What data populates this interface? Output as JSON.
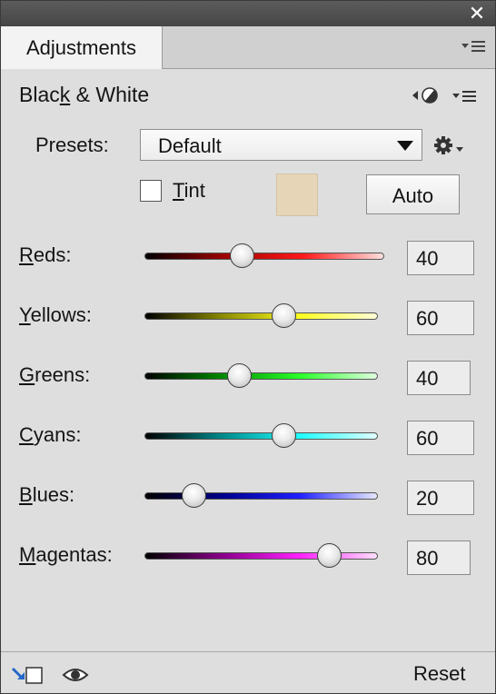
{
  "titlebar": {
    "close_icon": "close-icon"
  },
  "tabs": [
    {
      "label": "Adjustments"
    }
  ],
  "tab_menu_icon": "panel-menu-icon",
  "panel": {
    "title_prefix": "Blac",
    "title_ul": "k",
    "title_suffix": " & White",
    "mask_icon": "half-circle-mask-icon",
    "menu_icon": "panel-options-menu-icon"
  },
  "presets": {
    "label": "Presets:",
    "selected": "Default",
    "gear_icon": "gear-icon"
  },
  "tint": {
    "checked": false,
    "label_ul": "T",
    "label_rest": "int",
    "color": "#e6d6b7"
  },
  "auto_button": {
    "label": "Auto"
  },
  "channels": [
    {
      "ul": "R",
      "rest": "eds:",
      "value": "40",
      "fraction": 0.4,
      "gradient": [
        "#000000",
        "#9e0000",
        "#ff1a1a",
        "#ffe0e0"
      ]
    },
    {
      "ul": "Y",
      "rest": "ellows:",
      "value": "60",
      "fraction": 0.6,
      "gradient": [
        "#000000",
        "#8a8a00",
        "#ffff20",
        "#ffffd8"
      ]
    },
    {
      "ul": "G",
      "rest": "reens:",
      "value": "40",
      "fraction": 0.4,
      "gradient": [
        "#000000",
        "#008a00",
        "#2aff2a",
        "#e0ffe0"
      ]
    },
    {
      "ul": "C",
      "rest": "yans:",
      "value": "60",
      "fraction": 0.6,
      "gradient": [
        "#000000",
        "#008a8a",
        "#20ffff",
        "#e0ffff"
      ]
    },
    {
      "ul": "B",
      "rest": "lues:",
      "value": "20",
      "fraction": 0.2,
      "gradient": [
        "#000000",
        "#00008a",
        "#2020ff",
        "#e8e8ff"
      ]
    },
    {
      "ul": "M",
      "rest": "agentas:",
      "value": "80",
      "fraction": 0.8,
      "gradient": [
        "#000000",
        "#8a008a",
        "#ff20ff",
        "#ffe0ff"
      ]
    }
  ],
  "footer": {
    "clip_icon": "clip-to-layer-icon",
    "visibility_icon": "eye-icon",
    "reset_label": "Reset"
  }
}
